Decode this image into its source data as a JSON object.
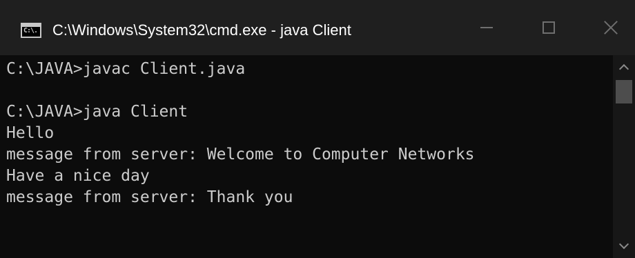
{
  "window": {
    "title": "C:\\Windows\\System32\\cmd.exe - java  Client",
    "app_icon_text": "C:\\."
  },
  "console": {
    "lines": [
      "C:\\JAVA>javac Client.java",
      "",
      "C:\\JAVA>java Client",
      "Hello",
      "message from server: Welcome to Computer Networks",
      "Have a nice day",
      "message from server: Thank you"
    ]
  },
  "icons": {
    "app": "console-icon",
    "minimize": "minimize-icon",
    "maximize": "maximize-icon",
    "close": "close-icon",
    "scroll_up": "chevron-up-icon",
    "scroll_down": "chevron-down-icon"
  },
  "colors": {
    "titlebar": "#1f1f1f",
    "console_bg": "#0c0c0c",
    "console_text": "#cccccc",
    "scrollbar_track": "#171717",
    "scrollbar_thumb": "#4d4d4d"
  }
}
